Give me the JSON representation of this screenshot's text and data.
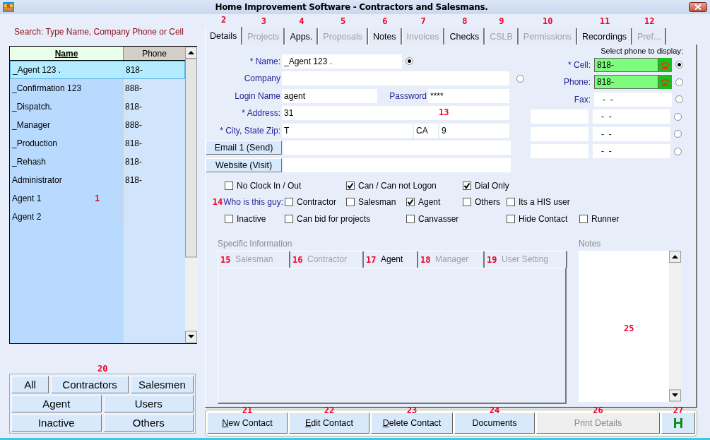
{
  "window": {
    "title": "Home Improvement Software - Contractors and Salesmans."
  },
  "search_label": "Search: Type Name, Company Phone or Cell",
  "contact_list": {
    "columns": [
      "Name",
      "Phone"
    ],
    "rows": [
      {
        "name": "_Agent 123 .",
        "phone": "818-",
        "selected": true
      },
      {
        "name": "_Confirmation 123",
        "phone": "888-",
        "selected": false
      },
      {
        "name": "_Dispatch.",
        "phone": "818-",
        "selected": false
      },
      {
        "name": "_Manager",
        "phone": "888-",
        "selected": false
      },
      {
        "name": "_Production",
        "phone": "818-",
        "selected": false
      },
      {
        "name": "_Rehash",
        "phone": "818-",
        "selected": false
      },
      {
        "name": "Administrator",
        "phone": "818-",
        "selected": false
      },
      {
        "name": "Agent 1",
        "selected": false,
        "callout": "1"
      },
      {
        "name": "Agent 2",
        "selected": false
      }
    ]
  },
  "filter_buttons": {
    "callout": "20",
    "rows": [
      [
        "All",
        "Contractors",
        "Salesmen"
      ],
      [
        "Agent",
        "Users"
      ],
      [
        "Inactive",
        "Others"
      ]
    ]
  },
  "tabs": [
    {
      "label": "Details",
      "callout": "2",
      "selected": true,
      "disabled": false
    },
    {
      "label": "Projects",
      "callout": "3",
      "selected": false,
      "disabled": true
    },
    {
      "label": "Apps.",
      "callout": "4",
      "selected": false,
      "disabled": false
    },
    {
      "label": "Proposals",
      "callout": "5",
      "selected": false,
      "disabled": true
    },
    {
      "label": "Notes",
      "callout": "6",
      "selected": false,
      "disabled": false
    },
    {
      "label": "Invoices",
      "callout": "7",
      "selected": false,
      "disabled": true
    },
    {
      "label": "Checks",
      "callout": "8",
      "selected": false,
      "disabled": false
    },
    {
      "label": "CSLB",
      "callout": "9",
      "selected": false,
      "disabled": true
    },
    {
      "label": "Permissions",
      "callout": "10",
      "selected": false,
      "disabled": true
    },
    {
      "label": "Recordings",
      "callout": "11",
      "selected": false,
      "disabled": false
    },
    {
      "label": "Pref...",
      "callout": "12",
      "selected": false,
      "disabled": true
    }
  ],
  "name": {
    "label": "* Name:",
    "value": "_Agent 123 .",
    "selected": true
  },
  "company": {
    "label": "Company",
    "selected": false
  },
  "login": {
    "label": "Login Name",
    "value": "agent"
  },
  "password": {
    "label": "Password",
    "value": "****"
  },
  "address": {
    "label": "* Address:",
    "value": "31",
    "callout": "13"
  },
  "city_state_zip": {
    "label": "* City, State Zip:",
    "city": "T",
    "state": "CA",
    "zip": "9"
  },
  "email_button": "Email 1 (Send)",
  "website_button": "Website (Visit)",
  "phones": {
    "heading": "Select phone to display:",
    "entries": [
      {
        "kind": "labeled",
        "label": "* Cell:",
        "number": "818-",
        "dial": true,
        "selected": true
      },
      {
        "kind": "labeled",
        "label": "Phone:",
        "number": "818-",
        "dial": true,
        "selected": false
      },
      {
        "kind": "labeled",
        "label": "Fax:",
        "number": "-  -",
        "dial": false,
        "selected": false
      },
      {
        "kind": "extra",
        "number": "-  -",
        "dial": false,
        "selected": false
      },
      {
        "kind": "extra",
        "number": "-  -",
        "dial": false,
        "selected": false
      },
      {
        "kind": "extra",
        "number": "-  -",
        "dial": false,
        "selected": false
      }
    ]
  },
  "option_rows": [
    {
      "items": [
        {
          "label": "No Clock In / Out",
          "checked": false
        },
        {
          "label": "Can / Can not Logon",
          "checked": true
        },
        {
          "label": "Dial Only",
          "checked": true
        }
      ]
    },
    {
      "prefix": {
        "label": "Who is this guy:",
        "callout": "14"
      },
      "items": [
        {
          "label": "Contractor",
          "checked": false
        },
        {
          "label": "Salesman",
          "checked": false
        },
        {
          "label": "Agent",
          "checked": true
        },
        {
          "label": "Others",
          "checked": false
        },
        {
          "label": "Its a HIS user",
          "checked": false
        }
      ]
    },
    {
      "items": [
        {
          "label": "Inactive",
          "checked": false
        },
        {
          "label": "Can bid for projects",
          "checked": false
        },
        {
          "label": "Canvasser",
          "checked": false
        },
        {
          "label": "Hide Contact",
          "checked": false
        },
        {
          "label": "Runner",
          "checked": false
        }
      ]
    }
  ],
  "specific": {
    "heading": "Specific Information",
    "tabs": [
      {
        "label": "Salesman",
        "callout": "15",
        "selected": false
      },
      {
        "label": "Contractor",
        "callout": "16",
        "selected": false
      },
      {
        "label": "Agent",
        "callout": "17",
        "selected": true
      },
      {
        "label": "Manager",
        "callout": "18",
        "selected": false
      },
      {
        "label": "User Setting",
        "callout": "19",
        "selected": false
      }
    ]
  },
  "notes": {
    "heading": "Notes",
    "callout": "25"
  },
  "actions": [
    {
      "kind": "text",
      "label": "New Contact",
      "callout": "21",
      "mnemonic": true,
      "disabled": false
    },
    {
      "kind": "text",
      "label": "Edit Contact",
      "callout": "22",
      "mnemonic": true,
      "disabled": false
    },
    {
      "kind": "text",
      "label": "Delete Contact",
      "callout": "23",
      "mnemonic": true,
      "disabled": false
    },
    {
      "kind": "text",
      "label": "Documents",
      "callout": "24",
      "mnemonic": false,
      "disabled": false
    },
    {
      "kind": "text",
      "label": "Print Details",
      "callout": "26",
      "mnemonic": false,
      "disabled": true
    },
    {
      "kind": "letter",
      "label": "H",
      "callout": "27",
      "mnemonic": false,
      "disabled": false
    }
  ]
}
